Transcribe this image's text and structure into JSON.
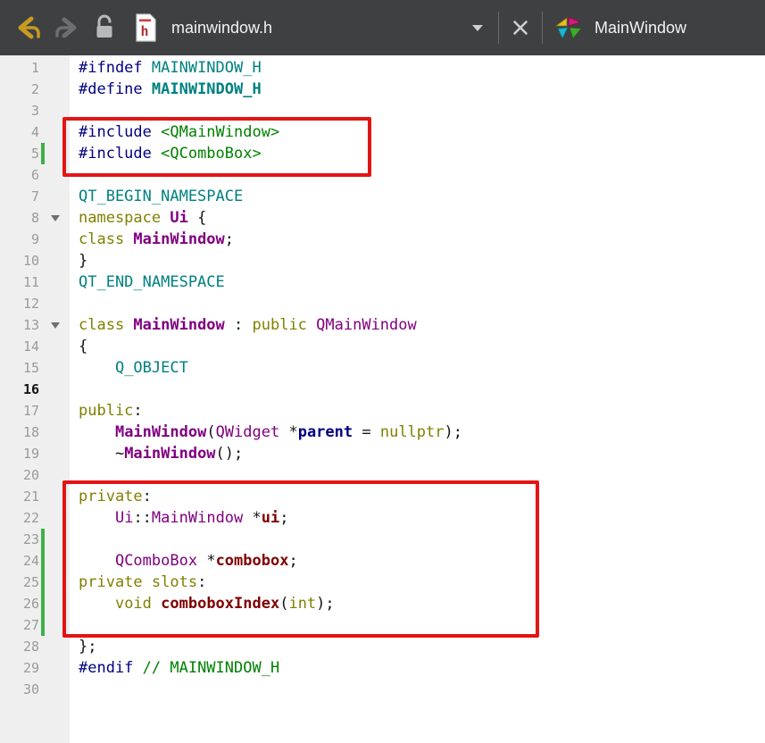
{
  "toolbar": {
    "file_name": "mainwindow.h",
    "symbol_name": "MainWindow"
  },
  "editor": {
    "lines": [
      {
        "n": 1,
        "seg": [
          [
            "pp",
            "#ifndef "
          ],
          [
            "macro",
            "MAINWINDOW_H"
          ]
        ]
      },
      {
        "n": 2,
        "seg": [
          [
            "pp",
            "#define "
          ],
          [
            "macrob",
            "MAINWINDOW_H"
          ]
        ]
      },
      {
        "n": 3,
        "seg": []
      },
      {
        "n": 4,
        "seg": [
          [
            "pp",
            "#include "
          ],
          [
            "str",
            "<QMainWindow>"
          ]
        ]
      },
      {
        "n": 5,
        "seg": [
          [
            "pp",
            "#include "
          ],
          [
            "str",
            "<QComboBox>"
          ]
        ],
        "changed": true
      },
      {
        "n": 6,
        "seg": []
      },
      {
        "n": 7,
        "seg": [
          [
            "macro",
            "QT_BEGIN_NAMESPACE"
          ]
        ]
      },
      {
        "n": 8,
        "seg": [
          [
            "kw",
            "namespace "
          ],
          [
            "typeb",
            "Ui"
          ],
          [
            "pl",
            " {"
          ]
        ],
        "fold": true
      },
      {
        "n": 9,
        "seg": [
          [
            "kw",
            "class "
          ],
          [
            "typeb",
            "MainWindow"
          ],
          [
            "pl",
            ";"
          ]
        ]
      },
      {
        "n": 10,
        "seg": [
          [
            "pl",
            "}"
          ]
        ]
      },
      {
        "n": 11,
        "seg": [
          [
            "macro",
            "QT_END_NAMESPACE"
          ]
        ]
      },
      {
        "n": 12,
        "seg": []
      },
      {
        "n": 13,
        "seg": [
          [
            "kw",
            "class "
          ],
          [
            "typeb",
            "MainWindow"
          ],
          [
            "pl",
            " : "
          ],
          [
            "kw",
            "public "
          ],
          [
            "type",
            "QMainWindow"
          ]
        ],
        "fold": true
      },
      {
        "n": 14,
        "seg": [
          [
            "pl",
            "{"
          ]
        ]
      },
      {
        "n": 15,
        "seg": [
          [
            "pl",
            "    "
          ],
          [
            "macro",
            "Q_OBJECT"
          ]
        ]
      },
      {
        "n": 16,
        "seg": [],
        "current": true
      },
      {
        "n": 17,
        "seg": [
          [
            "kw",
            "public"
          ],
          [
            "pl",
            ":"
          ]
        ]
      },
      {
        "n": 18,
        "seg": [
          [
            "pl",
            "    "
          ],
          [
            "typeb",
            "MainWindow"
          ],
          [
            "pl",
            "("
          ],
          [
            "type",
            "QWidget"
          ],
          [
            "pl",
            " *"
          ],
          [
            "loc",
            "parent"
          ],
          [
            "pl",
            " = "
          ],
          [
            "kw",
            "nullptr"
          ],
          [
            "pl",
            ");"
          ]
        ]
      },
      {
        "n": 19,
        "seg": [
          [
            "pl",
            "    ~"
          ],
          [
            "typeb",
            "MainWindow"
          ],
          [
            "pl",
            "();"
          ]
        ]
      },
      {
        "n": 20,
        "seg": []
      },
      {
        "n": 21,
        "seg": [
          [
            "kw",
            "private"
          ],
          [
            "pl",
            ":"
          ]
        ]
      },
      {
        "n": 22,
        "seg": [
          [
            "pl",
            "    "
          ],
          [
            "type",
            "Ui"
          ],
          [
            "pl",
            "::"
          ],
          [
            "type",
            "MainWindow"
          ],
          [
            "pl",
            " *"
          ],
          [
            "mem",
            "ui"
          ],
          [
            "pl",
            ";"
          ]
        ]
      },
      {
        "n": 23,
        "seg": [],
        "changed": true
      },
      {
        "n": 24,
        "seg": [
          [
            "pl",
            "    "
          ],
          [
            "type",
            "QComboBox"
          ],
          [
            "pl",
            " *"
          ],
          [
            "mem",
            "combobox"
          ],
          [
            "pl",
            ";"
          ]
        ],
        "changed": true
      },
      {
        "n": 25,
        "seg": [
          [
            "kw",
            "private slots"
          ],
          [
            "pl",
            ":"
          ]
        ],
        "changed": true
      },
      {
        "n": 26,
        "seg": [
          [
            "pl",
            "    "
          ],
          [
            "kw",
            "void "
          ],
          [
            "mem",
            "comboboxIndex"
          ],
          [
            "pl",
            "("
          ],
          [
            "kw",
            "int"
          ],
          [
            "pl",
            ");"
          ]
        ],
        "changed": true
      },
      {
        "n": 27,
        "seg": [],
        "changed": true
      },
      {
        "n": 28,
        "seg": [
          [
            "pl",
            "};"
          ]
        ]
      },
      {
        "n": 29,
        "seg": [
          [
            "pp",
            "#endif "
          ],
          [
            "cm",
            "// MAINWINDOW_H"
          ]
        ]
      },
      {
        "n": 30,
        "seg": []
      }
    ]
  },
  "colors": {
    "toolbar-bg": "#3e4042",
    "editor-bg": "#ffffff",
    "gutter-bg": "#efefef",
    "line-number": "#9b9b9b",
    "annotation-red": "#e41414",
    "change-green": "#3fae49",
    "back-arrow-gold": "#c79b21",
    "syntax-preprocessor": "#000080",
    "syntax-macro": "#008080",
    "syntax-keyword": "#808000",
    "syntax-type": "#800080",
    "syntax-string": "#008000",
    "syntax-member": "#800000",
    "syntax-local": "#000080",
    "syntax-comment": "#008000",
    "syntax-plain": "#141414"
  }
}
